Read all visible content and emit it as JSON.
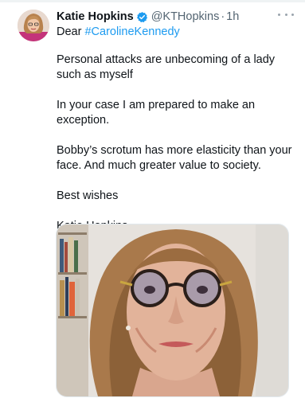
{
  "tweet": {
    "author_name": "Katie Hopkins",
    "handle": "@KTHopkins",
    "separator": "·",
    "time": "1h",
    "reply_prefix": "Dear ",
    "reply_hashtag": "#CarolineKennedy",
    "paragraphs": [
      "Personal attacks are unbecoming of a lady such as myself",
      "In your case I am prepared to make an exception.",
      "Bobby’s scrotum has more elasticity than your face. And much greater value to society.",
      "Best wishes",
      "Katie Hopkins"
    ]
  },
  "icons": {
    "verified": "verified-badge-icon",
    "more": "more-options-icon"
  },
  "colors": {
    "link": "#1d9bf0",
    "text": "#0f1419",
    "secondary": "#536471",
    "verified": "#1d9bf0"
  }
}
